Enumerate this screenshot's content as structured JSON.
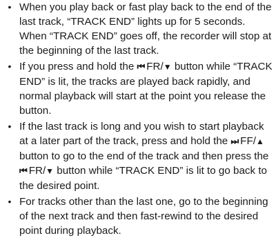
{
  "bullets": [
    {
      "segments": [
        {
          "type": "text",
          "value": "When you play back or fast play back to the end of the last track, “TRACK END” lights up for 5 seconds. When “TRACK END” goes off, the recorder will stop at the beginning of the last track."
        }
      ]
    },
    {
      "segments": [
        {
          "type": "text",
          "value": "If you press and hold the "
        },
        {
          "type": "icon",
          "icon": "rewind-icon",
          "glyph": "⏮"
        },
        {
          "type": "text",
          "value": "FR/"
        },
        {
          "type": "glyph",
          "icon": "down-triangle-icon",
          "glyph": "▼"
        },
        {
          "type": "text",
          "value": " button while “TRACK END” is lit, the tracks are played back rapidly, and normal playback will start at the point you release the button."
        }
      ]
    },
    {
      "segments": [
        {
          "type": "text",
          "value": "If the last track is long and you wish to start playback at a later part of the track, press and hold the "
        },
        {
          "type": "icon",
          "icon": "fast-forward-icon",
          "glyph": "⏭"
        },
        {
          "type": "text",
          "value": "FF/"
        },
        {
          "type": "glyph",
          "icon": "up-triangle-icon",
          "glyph": "▲"
        },
        {
          "type": "text",
          "value": " button to go to the end of the track and then press the "
        },
        {
          "type": "icon",
          "icon": "rewind-icon",
          "glyph": "⏮"
        },
        {
          "type": "text",
          "value": "FR/"
        },
        {
          "type": "glyph",
          "icon": "down-triangle-icon",
          "glyph": "▼"
        },
        {
          "type": "text",
          "value": " button while “TRACK END” is lit to go back to the desired point."
        }
      ]
    },
    {
      "segments": [
        {
          "type": "text",
          "value": "For tracks other than the last one, go to the beginning of the next track and then fast-rewind to the desired point during playback."
        }
      ]
    }
  ]
}
